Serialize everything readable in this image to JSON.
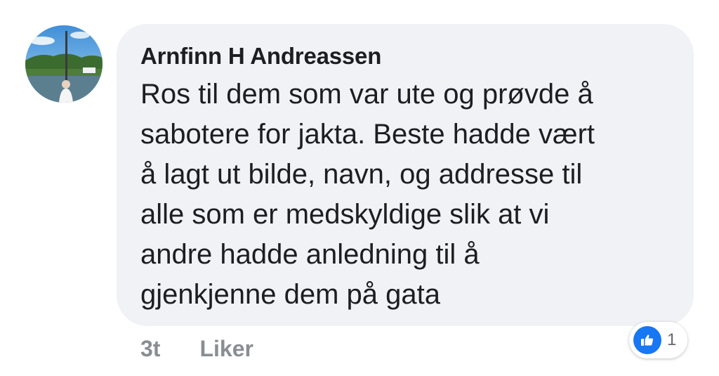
{
  "comment": {
    "author": "Arnfinn H Andreassen",
    "lines": [
      "Ros til dem som var ute og prøvde å",
      "sabotere for jakta. Beste hadde vært",
      "å lagt ut bilde, navn, og addresse til",
      "alle som er medskyldige slik at vi",
      "andre hadde anledning til å",
      "gjenkjenne dem på gata"
    ]
  },
  "actions": {
    "timestamp": "3t",
    "like_label": "Liker"
  },
  "reactions": {
    "icon": "thumbs-up-icon",
    "count": "1",
    "color": "#1877f2"
  }
}
